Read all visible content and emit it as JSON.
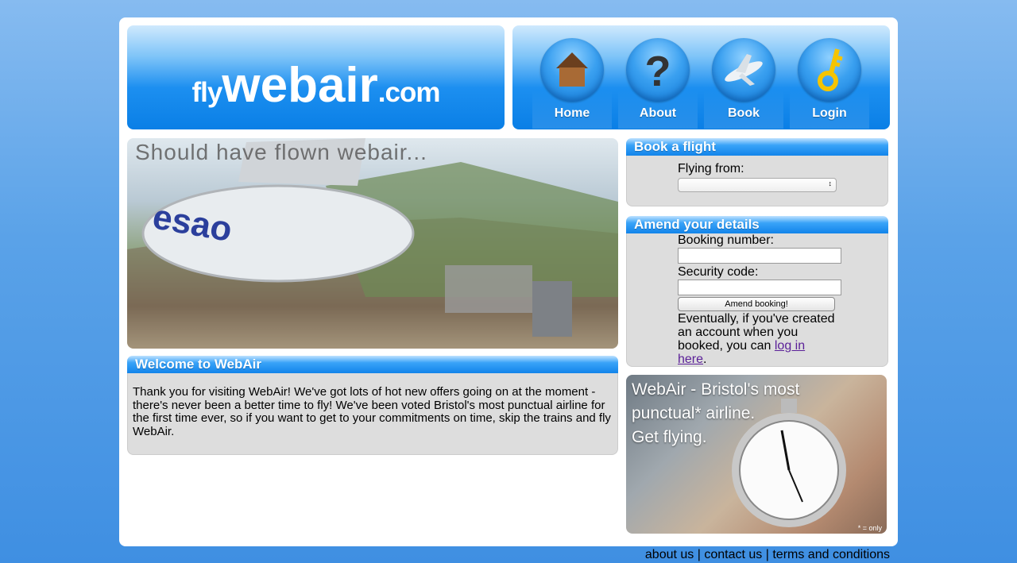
{
  "logo": {
    "prefix": "fly",
    "main": "webair",
    "suffix": ".com"
  },
  "nav": [
    {
      "label": "Home",
      "icon": "house-icon"
    },
    {
      "label": "About",
      "icon": "question-mark-icon"
    },
    {
      "label": "Book",
      "icon": "airplane-icon"
    },
    {
      "label": "Login",
      "icon": "key-icon"
    }
  ],
  "hero": {
    "caption": "Should have flown webair..."
  },
  "welcome": {
    "title": "Welcome to WebAir",
    "body": "Thank you for visiting WebAir! We've got lots of hot new offers going on at the moment - there's never been a better time to fly! We've been voted Bristol's most punctual airline for the first time ever, so if you want to get to your commitments on time, skip the trains and fly WebAir."
  },
  "book": {
    "title": "Book a flight",
    "flying_from_label": "Flying from:",
    "flying_from_value": ""
  },
  "amend": {
    "title": "Amend your details",
    "booking_number_label": "Booking number:",
    "security_code_label": "Security code:",
    "button_label": "Amend booking!",
    "note_before": "Eventually, if you've created an account when you booked, you can ",
    "note_link": "log in here",
    "note_after": "."
  },
  "promo": {
    "line1": "WebAir - Bristol's most",
    "line2": "punctual* airline.",
    "line3": "Get flying.",
    "footnote": "* = only"
  },
  "footer": {
    "links": [
      "about us",
      "contact us",
      "terms and conditions"
    ],
    "separator": "|"
  },
  "colors": {
    "brand_blue": "#1284ea",
    "link_visited": "#5a1f98",
    "box_gray": "#dddddd"
  }
}
